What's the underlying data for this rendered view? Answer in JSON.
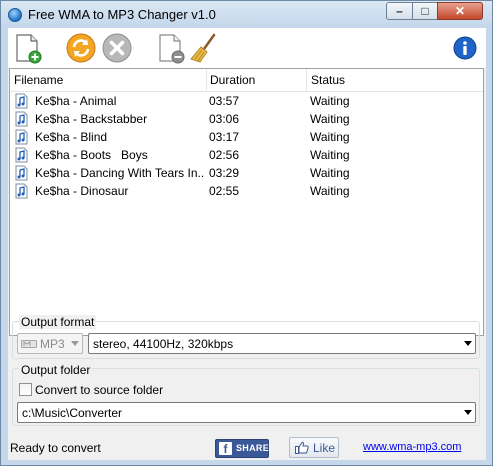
{
  "window": {
    "title": "Free WMA to MP3 Changer v1.0",
    "controls": {
      "minimize": "–",
      "maximize": "□",
      "close": "✕"
    }
  },
  "toolbar": {
    "buttons": [
      {
        "name": "add-files",
        "icon": "add-file-icon"
      },
      {
        "name": "convert",
        "icon": "convert-icon"
      },
      {
        "name": "stop",
        "icon": "stop-icon"
      },
      {
        "name": "remove",
        "icon": "remove-file-icon"
      },
      {
        "name": "clear",
        "icon": "broom-icon"
      },
      {
        "name": "about",
        "icon": "info-icon"
      }
    ]
  },
  "file_list": {
    "columns": [
      "Filename",
      "Duration",
      "Status"
    ],
    "rows": [
      {
        "filename": "Ke$ha - Animal",
        "duration": "03:57",
        "status": "Waiting"
      },
      {
        "filename": "Ke$ha - Backstabber",
        "duration": "03:06",
        "status": "Waiting"
      },
      {
        "filename": "Ke$ha - Blind",
        "duration": "03:17",
        "status": "Waiting"
      },
      {
        "filename": "Ke$ha - Boots   Boys",
        "duration": "02:56",
        "status": "Waiting"
      },
      {
        "filename": "Ke$ha - Dancing With Tears In...",
        "duration": "03:29",
        "status": "Waiting"
      },
      {
        "filename": "Ke$ha - Dinosaur",
        "duration": "02:55",
        "status": "Waiting"
      }
    ]
  },
  "output_format": {
    "label": "Output format",
    "format_value": "MP3",
    "quality_value": "stereo, 44100Hz, 320kbps"
  },
  "output_folder": {
    "label": "Output folder",
    "convert_to_source_label": "Convert to source folder",
    "convert_to_source_checked": false,
    "path_value": "c:\\Music\\Converter"
  },
  "statusbar": {
    "status_text": "Ready to convert",
    "share_label": "SHARE",
    "like_label": "Like",
    "site_link": "www.wma-mp3.com"
  },
  "colors": {
    "titlebar": "#c5d7ea",
    "link": "#0000ee",
    "facebook": "#3b5998"
  }
}
